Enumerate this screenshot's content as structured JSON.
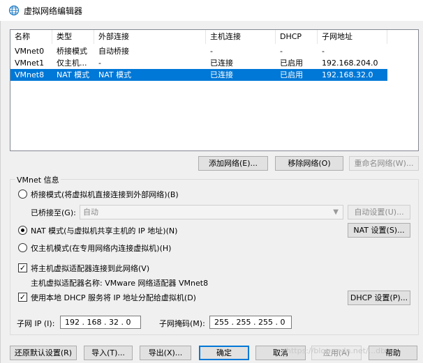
{
  "window": {
    "title": "虚拟网络编辑器",
    "icon": "globe-icon"
  },
  "table": {
    "columns": [
      "名称",
      "类型",
      "外部连接",
      "主机连接",
      "DHCP",
      "子网地址"
    ],
    "rows": [
      {
        "name": "VMnet0",
        "type": "桥接模式",
        "external": "自动桥接",
        "host": "-",
        "dhcp": "-",
        "subnet": "-"
      },
      {
        "name": "VMnet1",
        "type": "仅主机...",
        "external": "-",
        "host": "已连接",
        "dhcp": "已启用",
        "subnet": "192.168.204.0"
      },
      {
        "name": "VMnet8",
        "type": "NAT 模式",
        "external": "NAT 模式",
        "host": "已连接",
        "dhcp": "已启用",
        "subnet": "192.168.32.0"
      }
    ],
    "selected_index": 2
  },
  "list_buttons": {
    "add": "添加网络(E)...",
    "remove": "移除网络(O)",
    "rename": "重命名网络(W)..."
  },
  "vmnet_info": {
    "title": "VMnet 信息",
    "bridged_label": "桥接模式(将虚拟机直接连接到外部网络)(B)",
    "bridged_to_label": "已桥接至(G):",
    "bridged_to_value": "自动",
    "auto_settings": "自动设置(U)...",
    "nat_label": "NAT 模式(与虚拟机共享主机的 IP 地址)(N)",
    "nat_settings": "NAT 设置(S)...",
    "hostonly_label": "仅主机模式(在专用网络内连接虚拟机)(H)",
    "connect_adapter_label": "将主机虚拟适配器连接到此网络(V)",
    "adapter_name_label": "主机虚拟适配器名称: VMware 网络适配器 VMnet8",
    "dhcp_label": "使用本地 DHCP 服务将 IP 地址分配给虚拟机(D)",
    "dhcp_settings": "DHCP 设置(P)...",
    "subnet_ip_label": "子网 IP (I):",
    "subnet_ip_value": "192 . 168 . 32 . 0",
    "subnet_mask_label": "子网掩码(M):",
    "subnet_mask_value": "255 . 255 . 255 . 0"
  },
  "footer_buttons": {
    "restore": "还原默认设置(R)",
    "import": "导入(T)...",
    "export": "导出(X)...",
    "ok": "确定",
    "cancel": "取消",
    "apply": "应用(A)",
    "help": "帮助"
  },
  "watermark": "https://blog.csdn.net/...db",
  "colors": {
    "selection": "#0078d7",
    "primary_border": "#0078d7"
  }
}
